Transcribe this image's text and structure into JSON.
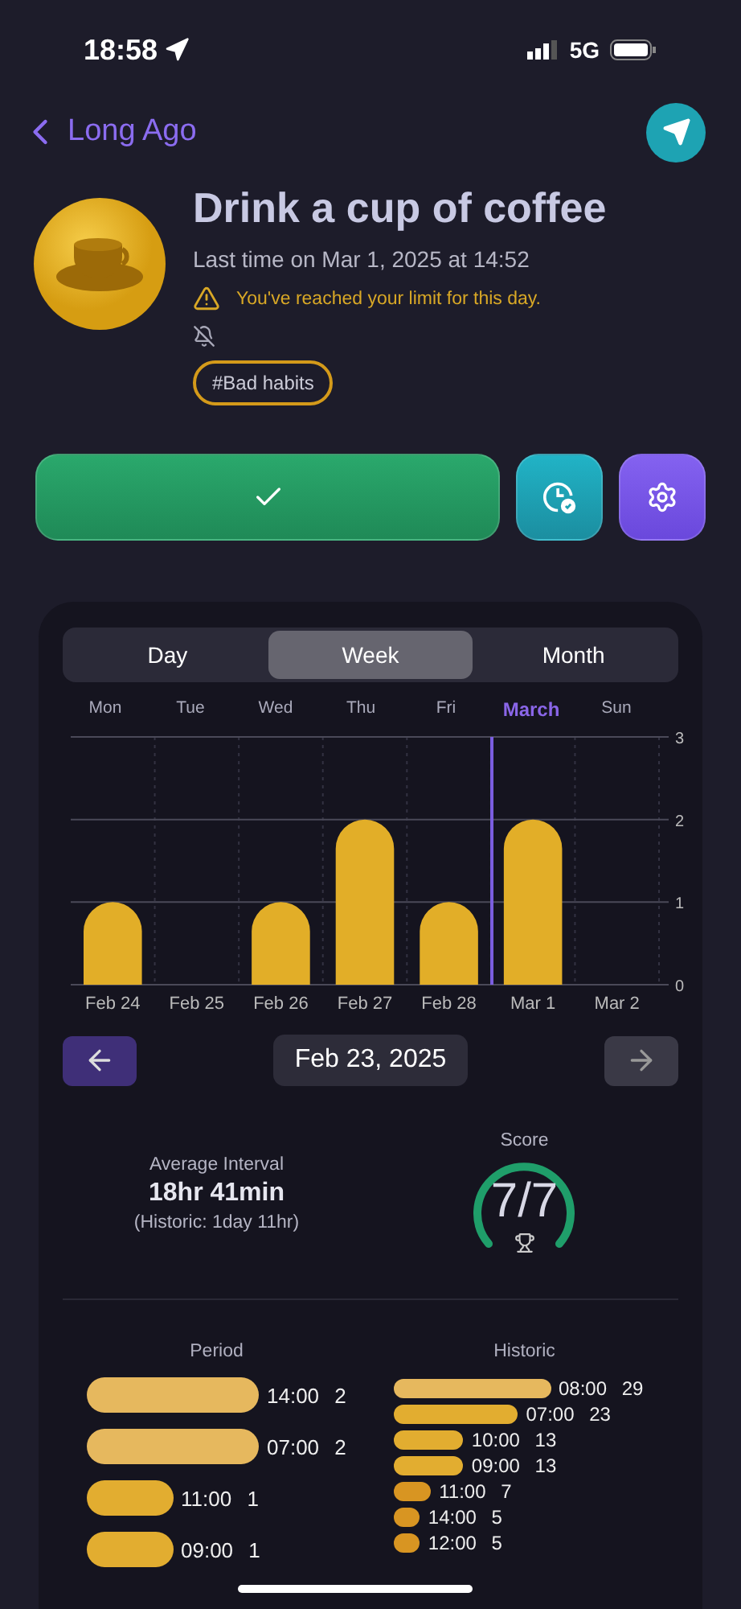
{
  "status_bar": {
    "time": "18:58",
    "network": "5G"
  },
  "nav": {
    "back_label": "Long Ago"
  },
  "habit": {
    "title": "Drink a cup of coffee",
    "last_time": "Last time on Mar 1, 2025 at 14:52",
    "warning": "You've reached your limit for this day.",
    "tag": "#Bad habits"
  },
  "actions": [
    {
      "kind": "check"
    },
    {
      "kind": "history"
    },
    {
      "kind": "settings"
    }
  ],
  "period_tabs": [
    {
      "label": "Day",
      "selected": false
    },
    {
      "label": "Week",
      "selected": true
    },
    {
      "label": "Month",
      "selected": false
    }
  ],
  "weekdays": [
    {
      "label": "Mon",
      "highlight": false
    },
    {
      "label": "Tue",
      "highlight": false
    },
    {
      "label": "Wed",
      "highlight": false
    },
    {
      "label": "Thu",
      "highlight": false
    },
    {
      "label": "Fri",
      "highlight": false
    },
    {
      "label": "March",
      "highlight": true
    },
    {
      "label": "Sun",
      "highlight": false
    }
  ],
  "chart": {
    "chart_data": {
      "type": "bar",
      "categories": [
        "Feb 24",
        "Feb 25",
        "Feb 26",
        "Feb 27",
        "Feb 28",
        "Mar 1",
        "Mar 2"
      ],
      "series": [
        {
          "color": "#e2ae28",
          "values": [
            1,
            0,
            1,
            2,
            1,
            2,
            0
          ]
        }
      ],
      "ylim": [
        0,
        3
      ],
      "yticks": [
        0,
        1,
        2,
        3
      ]
    }
  },
  "date_nav": {
    "date": "Feb 23, 2025"
  },
  "average": {
    "label": "Average Interval",
    "value": "18hr 41min",
    "historic": "(Historic: 1day 11hr)"
  },
  "score": {
    "label": "Score",
    "value": "7/7"
  },
  "period": {
    "title": "Period",
    "rows": [
      {
        "time": "14:00",
        "count": "2"
      },
      {
        "time": "07:00",
        "count": "2"
      },
      {
        "time": "11:00",
        "count": "1"
      },
      {
        "time": "09:00",
        "count": "1"
      }
    ]
  },
  "historic": {
    "title": "Historic",
    "rows": [
      {
        "time": "08:00",
        "count": "29"
      },
      {
        "time": "07:00",
        "count": "23"
      },
      {
        "time": "10:00",
        "count": "13"
      },
      {
        "time": "09:00",
        "count": "13"
      },
      {
        "time": "11:00",
        "count": "7"
      },
      {
        "time": "14:00",
        "count": "5"
      },
      {
        "time": "12:00",
        "count": "5"
      }
    ]
  }
}
